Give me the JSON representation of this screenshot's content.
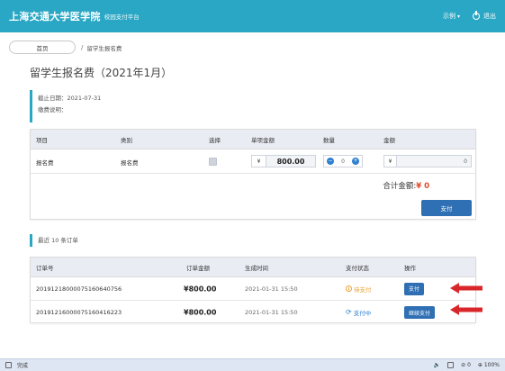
{
  "header": {
    "brand": "上海交通大学医学院",
    "subtitle": "校园支付平台",
    "user_menu": "示例",
    "logout": "退出"
  },
  "breadcrumb": {
    "home": "首页",
    "separator": "/",
    "current": "留学生报名费"
  },
  "page_title": "留学生报名费（2021年1月）",
  "notice": {
    "deadline": "截止日期：2021-07-31",
    "fee_desc": "缴费说明："
  },
  "fee_table": {
    "headers": [
      "项目",
      "类别",
      "选择",
      "单项金额",
      "数量",
      "金额"
    ],
    "row": {
      "item": "报名费",
      "category": "报名费",
      "currency": "¥",
      "unit_price": "800.00",
      "qty_minus": "−",
      "quantity": "0",
      "qty_plus": "+",
      "amount_currency": "¥",
      "amount": "0"
    },
    "total_label": "合计金额:",
    "total_value": "¥ 0",
    "pay_button": "支付"
  },
  "recent": {
    "title": "最近 10 条订单",
    "headers": [
      "订单号",
      "订单金额",
      "生成时间",
      "支付状态",
      "操作"
    ],
    "rows": [
      {
        "order_no": "20191218000075160640756",
        "amount": "¥800.00",
        "time": "2021-01-31 15:50",
        "status": "待支付",
        "action": "支付"
      },
      {
        "order_no": "20191216000075160416223",
        "amount": "¥800.00",
        "time": "2021-01-31 15:50",
        "status": "支付中",
        "action": "继续支付"
      }
    ]
  },
  "statusbar": {
    "left_text": "完成",
    "right_count": "0",
    "zoom": "100%"
  },
  "colors": {
    "topbar": "#2aa7c4",
    "primary_button": "#2f6fb3",
    "total_red": "#e04a2c",
    "arrow_red": "#d9262a",
    "status_pending": "#e8a23a",
    "status_paying": "#2f7fcf"
  }
}
